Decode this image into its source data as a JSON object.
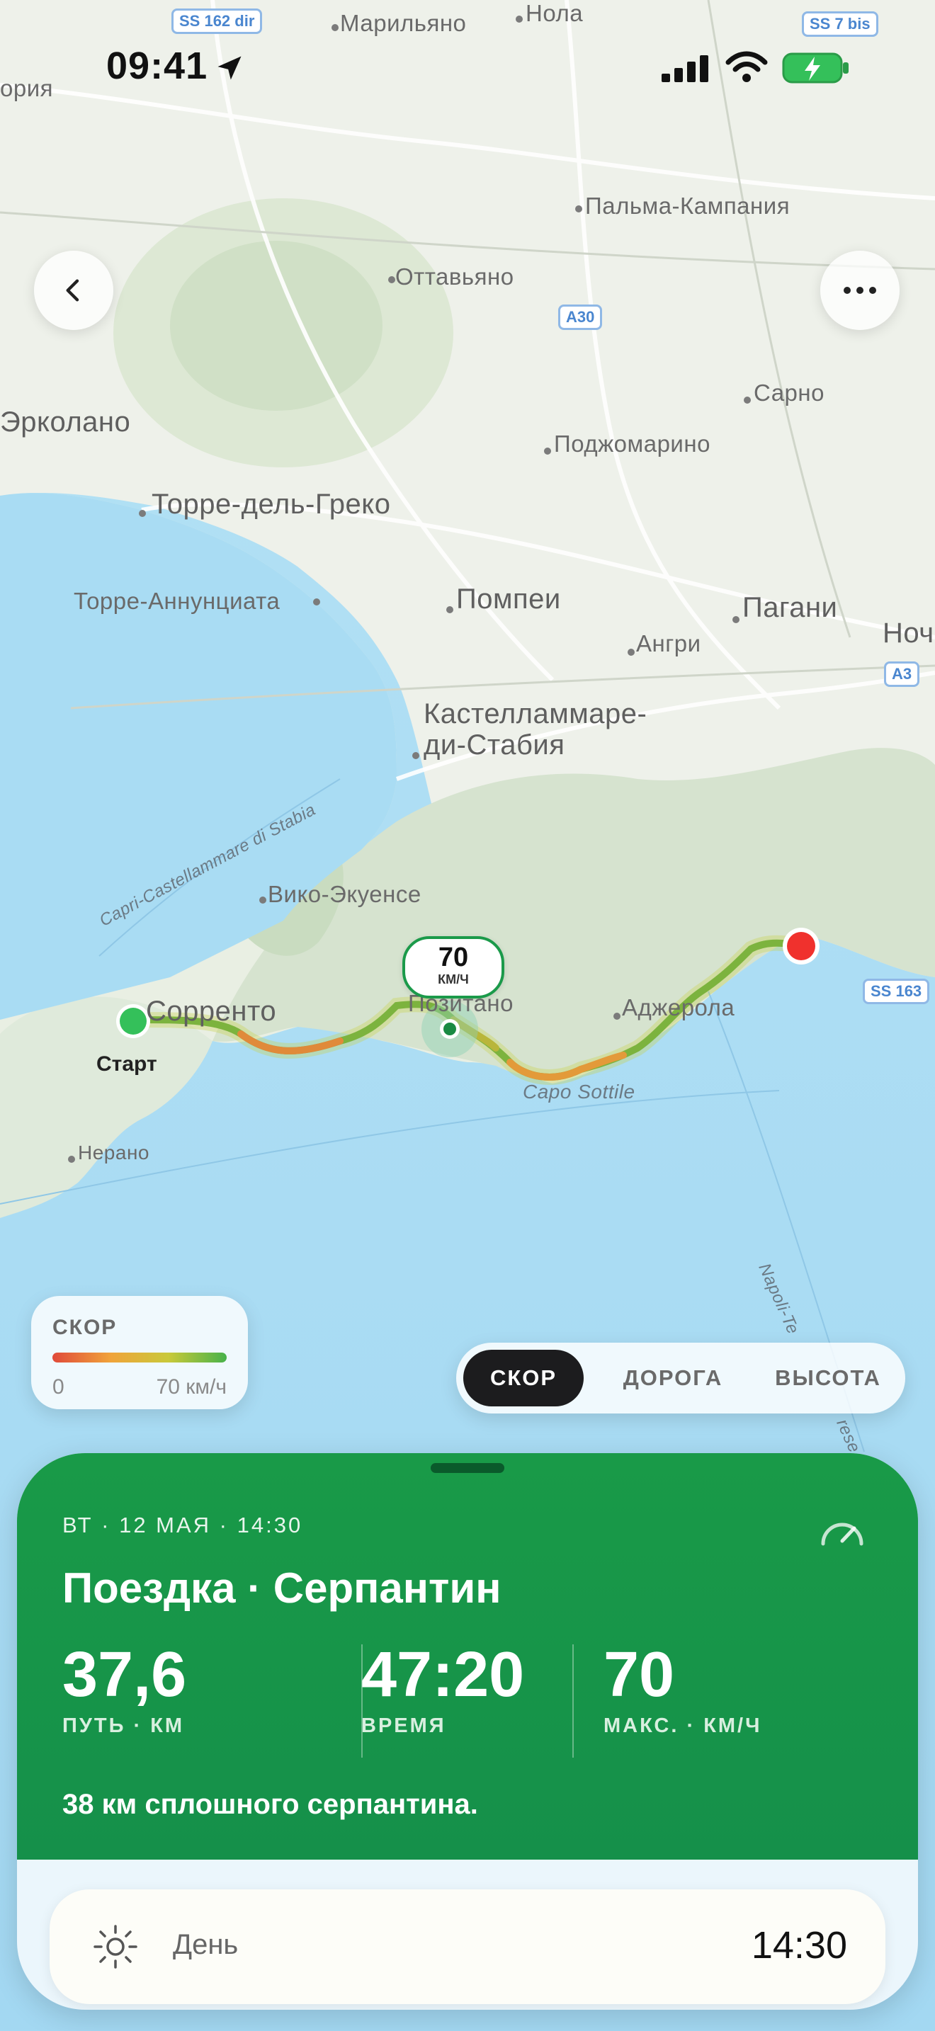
{
  "status_bar": {
    "time": "09:41"
  },
  "map": {
    "labels": {
      "marilyano": "Марильяно",
      "nola": "Нола",
      "ia": "ория",
      "palma": "Пальма-Кампания",
      "ottaviano": "Оттавьяно",
      "sarno": "Сарно",
      "ercolano": "Эрколано",
      "podjomarino": "Поджомарино",
      "torre_greco": "Торре-дель-Греко",
      "torre_ann": "Торре-Аннунциата",
      "pompei": "Помпеи",
      "pagani": "Пагани",
      "nocera": "Ноч",
      "angri": "Ангри",
      "castellammare1": "Кастелламмаре-",
      "castellammare2": "ди-Стабия",
      "vico": "Вико-Экуенсе",
      "sorrento": "Сорренто",
      "positano": "Позитано",
      "agerola": "Аджерола",
      "capo": "Capo Sottile",
      "nerano": "Нерано",
      "capri_road": "Capri-Castellammare di Stabia",
      "napoli_road": "Napoli-Te",
      "napoli_road2": "rese"
    },
    "shields": {
      "ss162": "SS 162 dir",
      "ss7": "SS 7 bis",
      "a30": "A30",
      "a3": "A3",
      "ss163": "SS 163"
    },
    "start_label": "Старт",
    "speed_bubble": {
      "value": "70",
      "unit": "КМ/Ч"
    }
  },
  "legend": {
    "title": "СКОР",
    "min": "0",
    "max": "70 км/ч"
  },
  "segmented": {
    "options": [
      "СКОР",
      "ДОРОГА",
      "ВЫСОТА"
    ],
    "selected": "СКОР"
  },
  "trip": {
    "date": "ВТ · 12 МАЯ · 14:30",
    "title": "Поездка · Серпантин",
    "stats": [
      {
        "value": "37,6",
        "label": "ПУТЬ · КМ"
      },
      {
        "value": "47:20",
        "label": "ВРЕМЯ"
      },
      {
        "value": "70",
        "label": "МАКС. · КМ/Ч"
      }
    ],
    "note": "38 км сплошного серпантина."
  },
  "detail_row": {
    "label": "День",
    "value": "14:30"
  },
  "icons": {
    "back": "chevron-left-icon",
    "more": "ellipsis-icon",
    "location": "location-arrow-icon",
    "signal": "cellular-signal-icon",
    "wifi": "wifi-icon",
    "battery": "battery-charging-icon",
    "speedometer": "speedometer-icon",
    "sun": "sun-icon"
  },
  "colors": {
    "accent_green": "#199a48",
    "end_marker": "#f0312d",
    "start_marker": "#34c05a"
  }
}
